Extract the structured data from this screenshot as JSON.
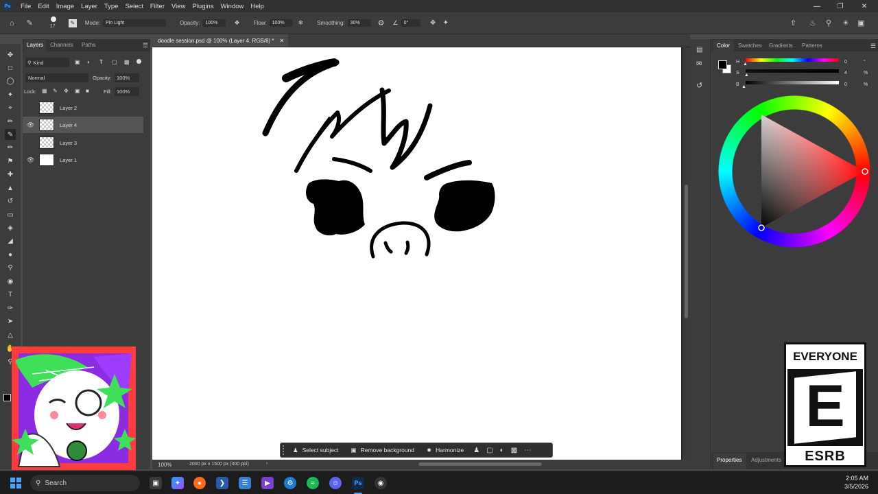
{
  "menubar": {
    "logo": "Ps",
    "items": [
      "File",
      "Edit",
      "Image",
      "Layer",
      "Type",
      "Select",
      "Filter",
      "View",
      "Plugins",
      "Window",
      "Help"
    ]
  },
  "options": {
    "brush_size": "17",
    "mode_label": "Mode:",
    "mode_value": "Pin Light",
    "opacity_label": "Opacity:",
    "opacity_value": "100%",
    "flow_label": "Flow:",
    "flow_value": "100%",
    "smoothing_label": "Smoothing:",
    "smoothing_value": "30%",
    "angle_value": "0°"
  },
  "layers_panel": {
    "tabs": [
      "Layers",
      "Channels",
      "Paths"
    ],
    "filter_kind": "Kind",
    "blend_mode": "Normal",
    "opacity_label": "Opacity:",
    "opacity_value": "100%",
    "lock_label": "Lock:",
    "fill_label": "Fill:",
    "fill_value": "100%",
    "layers": [
      {
        "name": "Layer 2",
        "visible": false,
        "selected": false
      },
      {
        "name": "Layer 4",
        "visible": true,
        "selected": true
      },
      {
        "name": "Layer 3",
        "visible": false,
        "selected": false
      },
      {
        "name": "Layer 1",
        "visible": true,
        "selected": false
      }
    ]
  },
  "document": {
    "tab_title": "doodle session.psd @ 100% (Layer 4, RGB/8) *",
    "zoom": "100%",
    "doc_info": "2000 px x 1500 px (300 ppi)"
  },
  "context_bar": {
    "select_subject": "Select subject",
    "remove_background": "Remove background",
    "harmonize": "Harmonize"
  },
  "color_panel": {
    "tabs": [
      "Color",
      "Swatches",
      "Gradients",
      "Patterns"
    ],
    "h_letter": "H",
    "h_value": "0",
    "h_unit": "°",
    "s_letter": "S",
    "s_value": "4",
    "s_unit": "%",
    "b_letter": "B",
    "b_value": "0",
    "b_unit": "%",
    "bottom_tabs": [
      "Properties",
      "Adjustments"
    ]
  },
  "esrb": {
    "rating_top": "EVERYONE",
    "letter": "E",
    "brand": "ESRB"
  },
  "taskbar": {
    "search_label": "Search",
    "time": "2:05 AM",
    "date": "3/5/2026"
  },
  "colors": {
    "ui_dark": "#323232",
    "ui_panel": "#3c3c3c",
    "canvas": "#ffffff",
    "brush": "#000000"
  }
}
